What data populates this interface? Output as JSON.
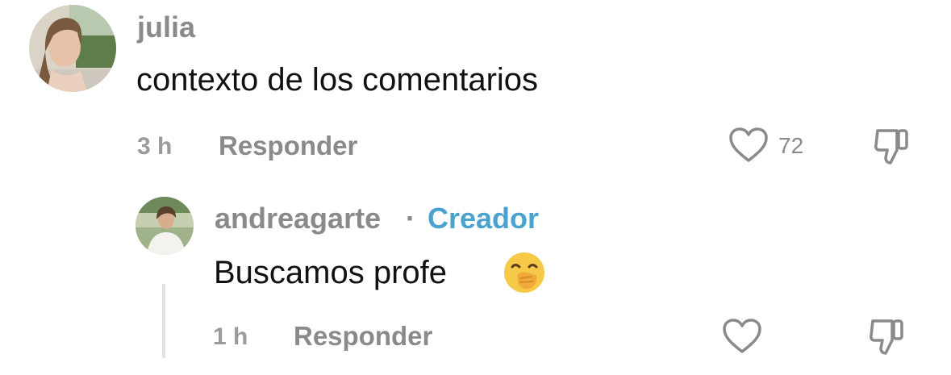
{
  "comment": {
    "username": "julia",
    "text": "contexto de los comentarios",
    "time": "3 h",
    "reply_label": "Responder",
    "like_count": "72",
    "icons": {
      "like": "heart-icon",
      "dislike": "thumbs-down-icon"
    }
  },
  "reply": {
    "username": "andreagarte",
    "separator": "·",
    "badge": "Creador",
    "text": "Buscamos profe",
    "emoji": "🤭",
    "time": "1 h",
    "reply_label": "Responder",
    "icons": {
      "like": "heart-icon",
      "dislike": "thumbs-down-icon"
    }
  },
  "colors": {
    "creator_badge": "#4aa3cf",
    "secondary_text": "#8a8a8a",
    "primary_text": "#111111"
  }
}
